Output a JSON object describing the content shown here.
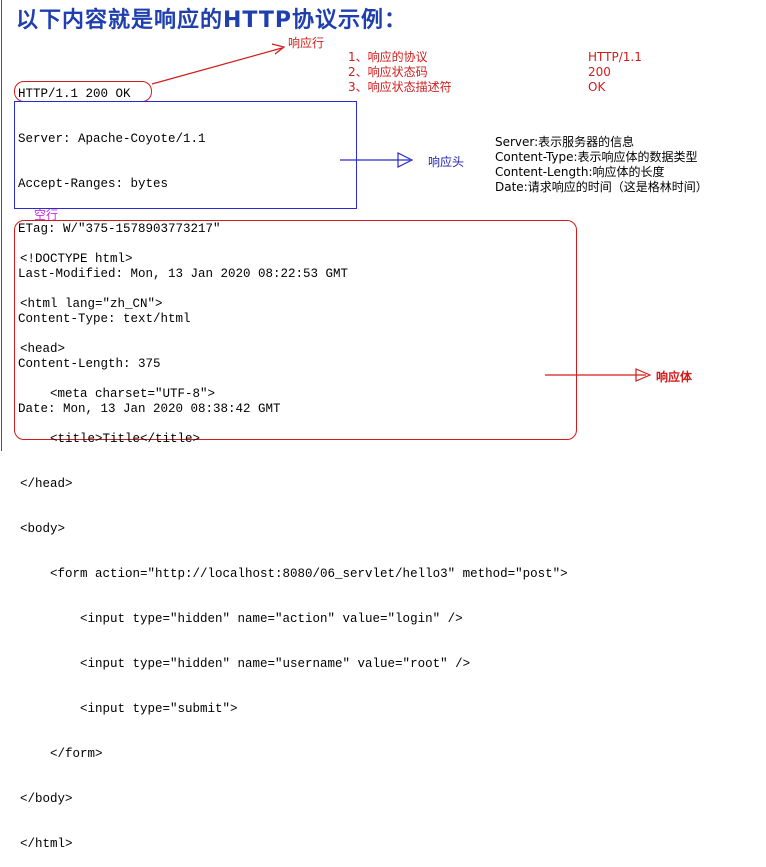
{
  "title": "以下内容就是响应的HTTP协议示例：",
  "labels": {
    "status_line": "响应行",
    "headers": "响应头",
    "blank_line": "空行",
    "body": "响应体"
  },
  "status_line_info": [
    {
      "name": "1、响应的协议",
      "value": "HTTP/1.1"
    },
    {
      "name": "2、响应状态码",
      "value": "200"
    },
    {
      "name": "3、响应状态描述符",
      "value": "OK"
    }
  ],
  "status_line": "HTTP/1.1 200 OK",
  "headers": [
    "Server: Apache-Coyote/1.1",
    "Accept-Ranges: bytes",
    "ETag: W/\"375-1578903773217\"",
    "Last-Modified: Mon, 13 Jan 2020 08:22:53 GMT",
    "Content-Type: text/html",
    "Content-Length: 375",
    "Date: Mon, 13 Jan 2020 08:38:42 GMT"
  ],
  "header_notes": [
    "Server:表示服务器的信息",
    "Content-Type:表示响应体的数据类型",
    "Content-Length:响应体的长度",
    "Date:请求响应的时间（这是格林时间）"
  ],
  "body_lines": [
    "<!DOCTYPE html>",
    "<html lang=\"zh_CN\">",
    "<head>",
    "    <meta charset=\"UTF-8\">",
    "    <title>Title</title>",
    "</head>",
    "<body>",
    "    <form action=\"http://localhost:8080/06_servlet/hello3\" method=\"post\">",
    "        <input type=\"hidden\" name=\"action\" value=\"login\" />",
    "        <input type=\"hidden\" name=\"username\" value=\"root\" />",
    "        <input type=\"submit\">",
    "    </form>",
    "</body>",
    "</html>"
  ]
}
